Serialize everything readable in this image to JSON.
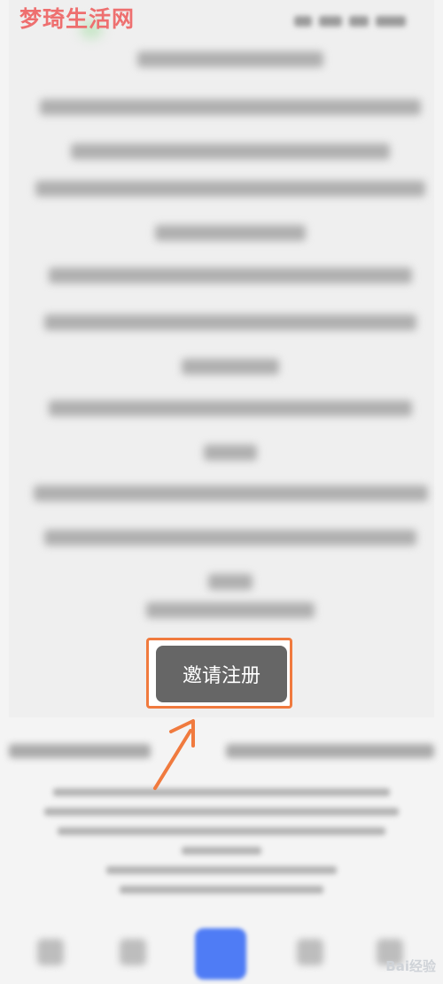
{
  "watermark": "梦琦生活网",
  "invite_button": {
    "label": "邀请注册"
  },
  "baidu_watermark": "Bai经验",
  "colors": {
    "highlight_border": "#f07a3e",
    "button_bg": "#666666",
    "arrow": "#f07a3e",
    "nav_accent": "#4f7cf5"
  },
  "icons": [
    "back-icon",
    "pin-icon",
    "home-icon",
    "chat-icon",
    "profile-icon"
  ]
}
